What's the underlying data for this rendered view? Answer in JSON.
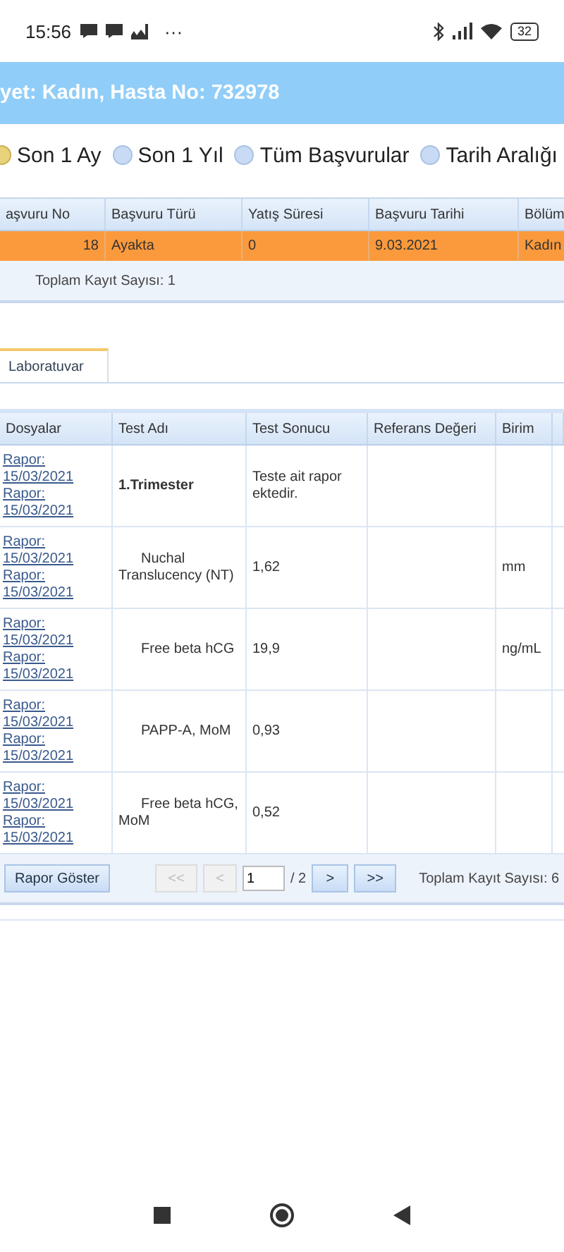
{
  "status_bar": {
    "time": "15:56",
    "more": "···",
    "battery": "32"
  },
  "header": {
    "title": "yet: Kadın, Hasta No: 732978"
  },
  "filters": [
    {
      "label": "Son 1 Ay",
      "selected": true
    },
    {
      "label": "Son 1 Yıl",
      "selected": false
    },
    {
      "label": "Tüm Başvurular",
      "selected": false
    },
    {
      "label": "Tarih Aralığı",
      "selected": false
    }
  ],
  "visits": {
    "columns": [
      "aşvuru No",
      "Başvuru Türü",
      "Yatış Süresi",
      "Başvuru Tarihi",
      "Bölüm"
    ],
    "rows": [
      {
        "cells": [
          "18",
          "Ayakta",
          "0",
          "9.03.2021",
          "Kadın"
        ],
        "selected": true
      }
    ],
    "total": "Toplam Kayıt Sayısı: 1"
  },
  "tabs": [
    {
      "label": "Laboratuvar",
      "selected": true
    }
  ],
  "lab": {
    "columns": [
      "Dosyalar",
      "Test Adı",
      "Test Sonucu",
      "Referans Değeri",
      "Birim"
    ],
    "rows": [
      {
        "files": [
          "Rapor: 15/03/2021",
          "Rapor: 15/03/2021"
        ],
        "test": "1.Trimester",
        "kind": "group",
        "result": "Teste ait rapor ektedir."
      },
      {
        "files": [
          "Rapor: 15/03/2021",
          "Rapor: 15/03/2021"
        ],
        "test": "Nuchal Translucency (NT)",
        "kind": "item",
        "result": "1,62",
        "unit": "mm"
      },
      {
        "files": [
          "Rapor: 15/03/2021",
          "Rapor: 15/03/2021"
        ],
        "test": "Free beta hCG",
        "kind": "item",
        "result": "19,9",
        "unit": "ng/mL"
      },
      {
        "files": [
          "Rapor: 15/03/2021",
          "Rapor: 15/03/2021"
        ],
        "test": "PAPP-A, MoM",
        "kind": "item",
        "result": "0,93"
      },
      {
        "files": [
          "Rapor: 15/03/2021",
          "Rapor: 15/03/2021"
        ],
        "test": "Free beta hCG, MoM",
        "kind": "item",
        "result": "0,52"
      }
    ],
    "report_button": "Rapor Göster",
    "pager": {
      "first": "<<",
      "prev": "<",
      "page": "1",
      "pages": "/ 2",
      "next": ">",
      "last": ">>",
      "first_disabled": true,
      "prev_disabled": true,
      "next_disabled": false,
      "last_disabled": false
    },
    "total": "Toplam Kayıt Sayısı: 6"
  }
}
